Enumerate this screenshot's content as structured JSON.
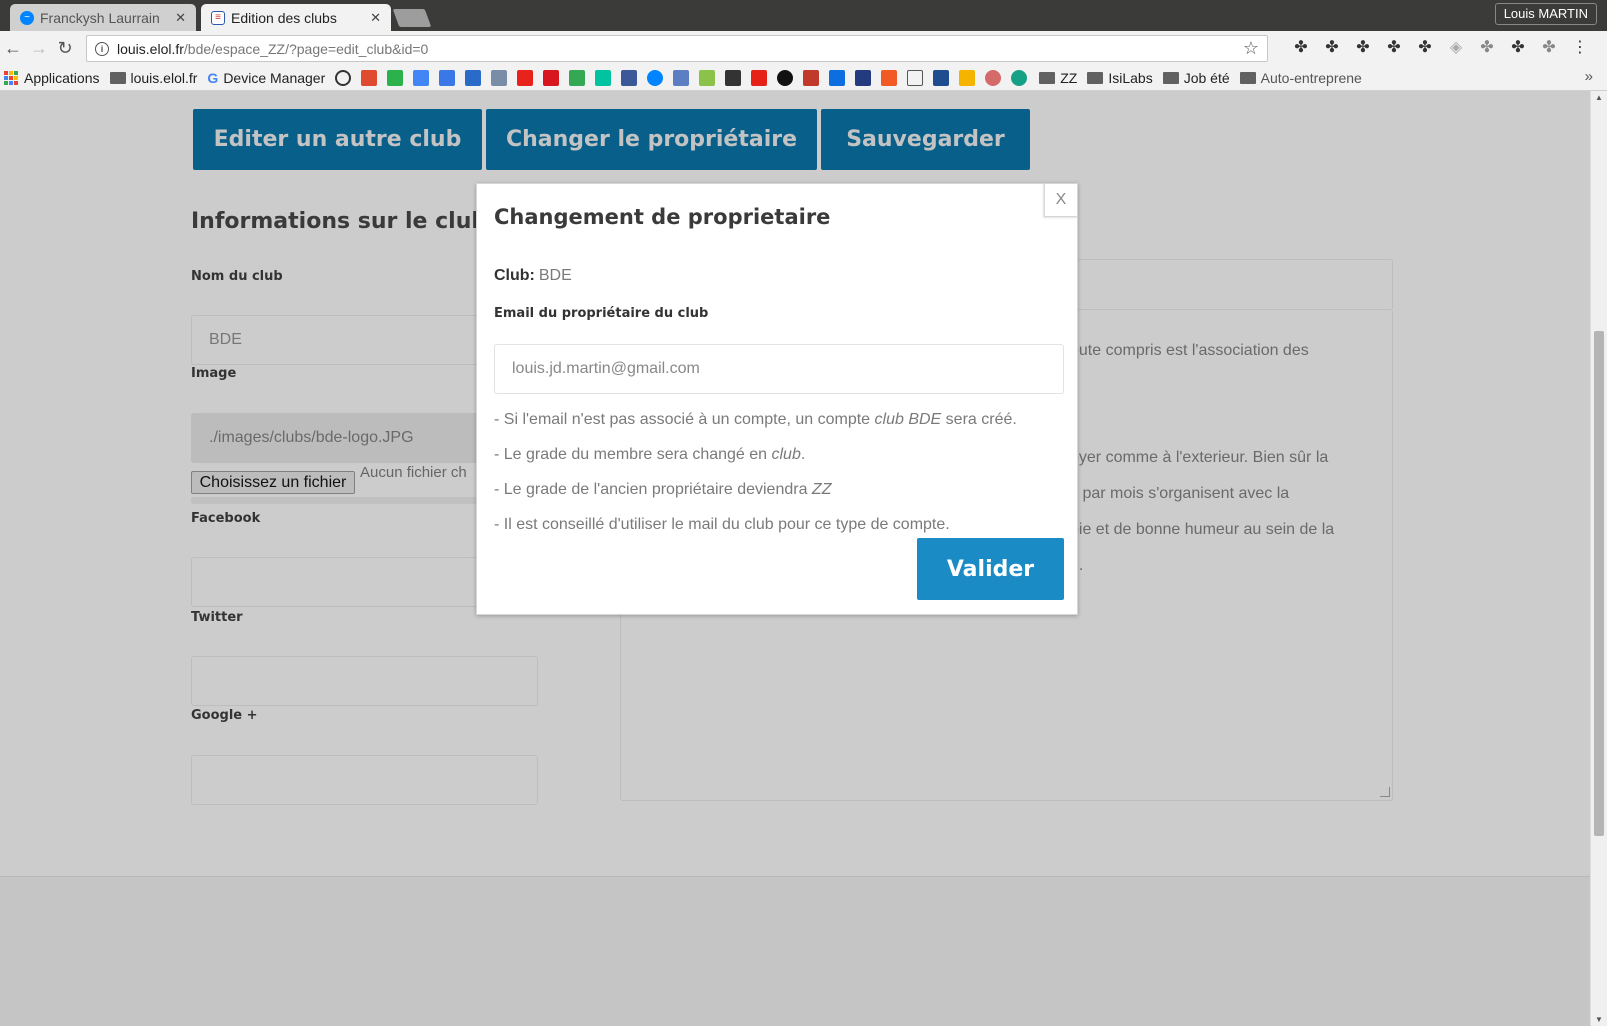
{
  "browser": {
    "tabs": [
      {
        "title": "Franckysh Laurrain",
        "active": false
      },
      {
        "title": "Edition des clubs",
        "active": true
      }
    ],
    "profile_name": "Louis MARTIN",
    "url_host": "louis.elol.fr",
    "url_path": "/bde/espace_ZZ/?page=edit_club&id=0",
    "bookmarks": {
      "apps_label": "Applications",
      "site_folder": "louis.elol.fr",
      "device_manager": "Device Manager",
      "folders": [
        "ZZ",
        "IsiLabs",
        "Job été",
        "Auto-entreprene"
      ]
    },
    "colors": {
      "accent_dark": "#08608a",
      "accent": "#1a8bc5",
      "overlay": "#cccccc"
    }
  },
  "page": {
    "buttons": {
      "edit_other": "Editer un autre club",
      "change_owner": "Changer le propriétaire",
      "save": "Sauvegarder"
    },
    "section_title": "Informations sur le club",
    "fields": {
      "name_label": "Nom du club",
      "name_value": "BDE",
      "image_label": "Image",
      "image_value": "./images/clubs/bde-logo.JPG",
      "file_button": "Choisissez un fichier",
      "file_status": "Aucun fichier ch",
      "facebook_label": "Facebook",
      "twitter_label": "Twitter",
      "google_label": "Google +"
    },
    "description_fragments": [
      "oute compris est l'association des",
      "oyer comme à l'exterieur. Bien sûr la",
      "s par mois s'organisent avec la",
      "pie et de bonne humeur au sein de la",
      "d."
    ]
  },
  "modal": {
    "title": "Changement de proprietaire",
    "close": "X",
    "club_label": "Club:",
    "club_value": "BDE",
    "email_label": "Email du propriétaire du club",
    "email_placeholder": "louis.jd.martin@gmail.com",
    "notes": {
      "n1_a": "- Si l'email n'est pas associé à un compte, un compte ",
      "n1_em": "club BDE",
      "n1_b": " sera créé.",
      "n2_a": "- Le grade du membre sera changé en ",
      "n2_em": "club",
      "n2_b": ".",
      "n3_a": "- Le grade de l'ancien propriétaire deviendra ",
      "n3_em": "ZZ",
      "n4": "- Il est conseillé d'utiliser le mail du club pour ce type de compte."
    },
    "submit": "Valider"
  }
}
